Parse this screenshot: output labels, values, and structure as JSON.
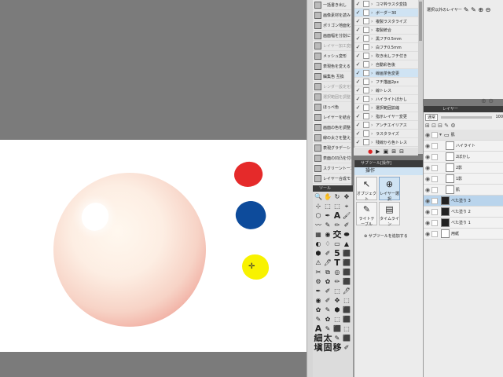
{
  "tool_panel": {
    "items": [
      {
        "label": "一括書き出し",
        "dim": false
      },
      {
        "label": "画像素材を読み",
        "dim": false
      },
      {
        "label": "ポリゴン地面化",
        "dim": false
      },
      {
        "label": "画面幅を分割にする",
        "dim": false
      },
      {
        "label": "レイヤー加工変形",
        "dim": true
      },
      {
        "label": "メッシュ変形",
        "dim": false
      },
      {
        "label": "表現色を変える",
        "dim": false
      },
      {
        "label": "編集色 互換",
        "dim": false
      },
      {
        "label": "レンダー設定を比較",
        "dim": true
      },
      {
        "label": "選択範囲を調整",
        "dim": true
      },
      {
        "label": "ほっぺ色",
        "dim": false
      },
      {
        "label": "レイヤーを結合",
        "dim": false
      },
      {
        "label": "画面の色を調整",
        "dim": false
      },
      {
        "label": "線の太さを整える",
        "dim": false
      },
      {
        "label": "表現グラデーション",
        "dim": false
      },
      {
        "label": "表面の凹凸を付ける",
        "dim": false
      },
      {
        "label": "スクリーントーン",
        "dim": false
      },
      {
        "label": "レイヤー合成モード",
        "dim": false
      }
    ]
  },
  "action_list": {
    "items": [
      {
        "label": "コマ枠ラスタ変換",
        "checked": true,
        "box": false,
        "selected": false
      },
      {
        "label": "ボーダー30",
        "checked": true,
        "box": true,
        "selected": true
      },
      {
        "label": "複製ラスタライズ",
        "checked": true,
        "box": false,
        "selected": false
      },
      {
        "label": "複製統合",
        "checked": true,
        "box": false,
        "selected": false
      },
      {
        "label": "黒フチ0.5mm",
        "checked": true,
        "box": false,
        "selected": false
      },
      {
        "label": "白フチ0.5mm",
        "checked": true,
        "box": false,
        "selected": false
      },
      {
        "label": "吹き出しフチ付き",
        "checked": true,
        "box": false,
        "selected": false
      },
      {
        "label": "自動彩色後",
        "checked": true,
        "box": false,
        "selected": false
      },
      {
        "label": "線画茶色変更",
        "checked": true,
        "box": false,
        "selected": true
      },
      {
        "label": "フチ描画2px",
        "checked": true,
        "box": false,
        "selected": false
      },
      {
        "label": "線トレス",
        "checked": true,
        "box": false,
        "selected": false
      },
      {
        "label": "ハイライトぼかし",
        "checked": true,
        "box": false,
        "selected": false
      },
      {
        "label": "選択範囲拡縮",
        "checked": true,
        "box": false,
        "selected": false
      },
      {
        "label": "指示レイヤー変更",
        "checked": true,
        "box": false,
        "selected": false
      },
      {
        "label": "アンチエイリアス",
        "checked": true,
        "box": false,
        "selected": false
      },
      {
        "label": "ラスタライズ",
        "checked": true,
        "box": false,
        "selected": false
      },
      {
        "label": "残線から色トレス",
        "checked": true,
        "box": false,
        "selected": false
      },
      {
        "label": "スクリーントーン化",
        "checked": true,
        "box": false,
        "selected": false
      }
    ],
    "controls": [
      "●",
      "▶",
      "▣",
      "⊞",
      "⊟"
    ]
  },
  "subtool": {
    "header": "サブツール[操作]",
    "current": "操作",
    "buttons": [
      {
        "label": "オブジェクト",
        "glyph": "↖",
        "selected": false
      },
      {
        "label": "レイヤー選択",
        "glyph": "⊕",
        "selected": true
      },
      {
        "label": "ライトテーブル",
        "glyph": "✎",
        "selected": false
      },
      {
        "label": "タイムライン",
        "glyph": "▤",
        "selected": false
      }
    ],
    "add_label": "サブツールを追加する"
  },
  "tool_palette": {
    "header": "ツール",
    "cells": [
      "🔍",
      "✋",
      "↻",
      "✥",
      "⊹",
      "⬚",
      "⬚",
      "⌖",
      "⬡",
      "✒",
      "A",
      "🖌",
      "〰",
      "✎",
      "✏",
      "✐",
      "▦",
      "◉",
      "交",
      "⬬",
      "◐",
      "♢",
      "▭",
      "▲",
      "⬢",
      "✐",
      "5",
      "⬛",
      "⚠",
      "🖊",
      "T",
      "⬛",
      "✂",
      "⧉",
      "◎",
      "⬛",
      "⚙",
      "✿",
      "✏",
      "⬛",
      "✒",
      "✐",
      "⬚",
      "🖊",
      "◉",
      "✐",
      "✥",
      "⬚",
      "✿",
      "✎",
      "⬢",
      "⬛",
      "✎",
      "✿",
      "⬚",
      "⬛",
      "A",
      "✎",
      "⬛",
      "⬚",
      "細",
      "太",
      "✎",
      "⬛",
      "塡",
      "固",
      "移",
      "✐"
    ]
  },
  "properties": {
    "label": "選択以外のレイヤー",
    "icons": "✎ ✎ ⊕ ⊖"
  },
  "layer_panel": {
    "header": "レイヤー",
    "blend_mode": "通常",
    "opacity": "100",
    "tool_icons": "⊞ ⊡ ⊟ ✎ ⚙",
    "layers": [
      {
        "name": "肌",
        "type": "folder",
        "selected": false,
        "black": false
      },
      {
        "name": "ハイライト",
        "type": "layer",
        "selected": false,
        "black": false
      },
      {
        "name": "2ぼかし",
        "type": "layer",
        "selected": false,
        "black": false
      },
      {
        "name": "2影",
        "type": "layer",
        "selected": false,
        "black": false
      },
      {
        "name": "1影",
        "type": "layer",
        "selected": false,
        "black": false
      },
      {
        "name": "肌",
        "type": "layer",
        "selected": false,
        "black": false
      },
      {
        "name": "べた塗り 3",
        "type": "layer",
        "selected": true,
        "black": true
      },
      {
        "name": "べた塗り 2",
        "type": "layer",
        "selected": false,
        "black": true
      },
      {
        "name": "べた塗り 1",
        "type": "layer",
        "selected": false,
        "black": true
      },
      {
        "name": "用紙",
        "type": "layer",
        "selected": false,
        "black": false
      }
    ]
  },
  "colors": {
    "red": "#e52a2a",
    "blue": "#0d4b9b",
    "yellow": "#f8f200"
  }
}
